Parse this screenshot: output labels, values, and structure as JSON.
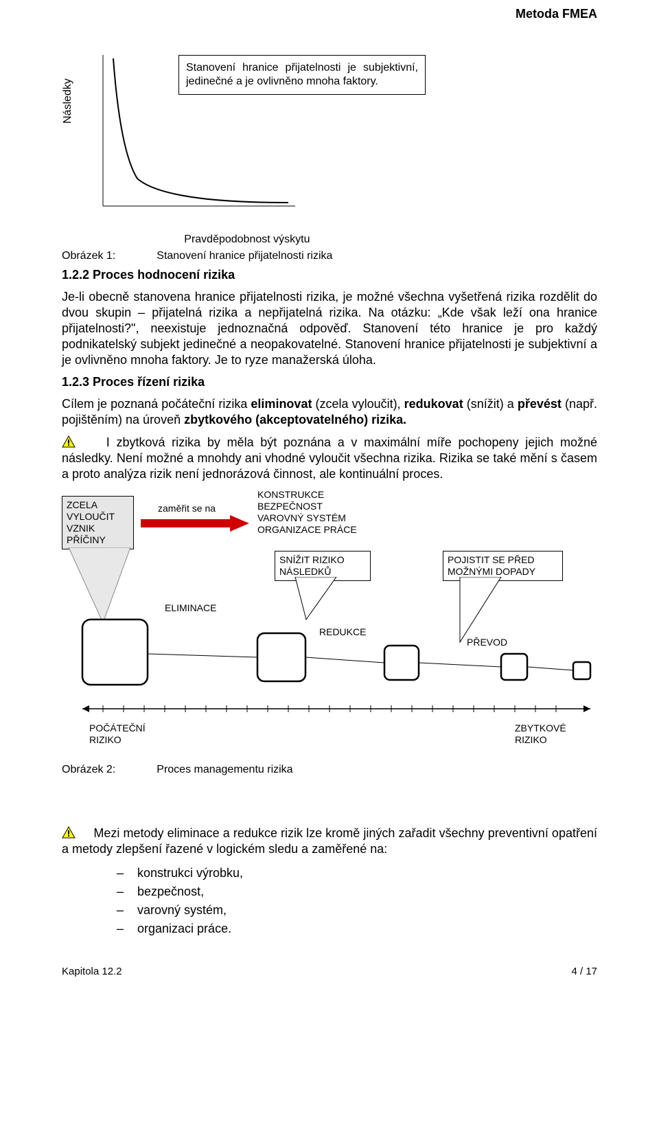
{
  "header": {
    "title": "Metoda FMEA"
  },
  "chart1": {
    "ylabel": "Následky",
    "note": "Stanovení hranice přijatelnosti je subjektivní, jedinečné a je ovlivněno mnoha faktory.",
    "xlabel": "Pravděpodobnost výskytu",
    "caption_left": "Obrázek 1:",
    "caption_right": "Stanovení hranice přijatelnosti rizika"
  },
  "sect122": {
    "title": "1.2.2  Proces hodnocení rizika",
    "p1": "Je-li obecně stanovena hranice přijatelnosti rizika, je možné všechna vyšetřená rizika rozdělit do dvou skupin – přijatelná rizika a nepřijatelná rizika. Na otázku: „Kde však leží ona hranice přijatelnosti?\", neexistuje jednoznačná odpověď. Stanovení této hranice je pro každý podnikatelský subjekt jedinečné a neopakovatelné. Stanovení hranice přijatelnosti je subjektivní a je ovlivněno mnoha faktory. Je to ryze manažerská úloha."
  },
  "sect123": {
    "title": "1.2.3  Proces řízení rizika",
    "p1_a": "Cílem je poznaná počáteční rizika ",
    "p1_b1": "eliminovat",
    "p1_c": " (zcela vyloučit), ",
    "p1_b2": "redukovat",
    "p1_d": " (snížit) a ",
    "p1_b3": "převést",
    "p1_e": " (např. pojištěním) na úroveň ",
    "p1_b4": "zbytkového (akceptovatelného) rizika.",
    "warn_a": "I zbytková rizika by měla být poznána a v maximální míře pochopeny jejich možné následky. Není možné a mnohdy ani vhodné vyloučit všechna rizika. Rizika se také mění s časem a proto analýza rizik není jednorázová činnost, ale kontinuální proces."
  },
  "diagram2": {
    "zcela": "ZCELA\nVYLOUČIT\nVZNIK\nPŘÍČINY",
    "zamerit": "zaměřit se na",
    "konstrukce": "KONSTRUKCE\nBEZPEČNOST\nVAROVNÝ SYSTÉM\nORGANIZACE PRÁCE",
    "snizit": "SNÍŽIT RIZIKO\nNÁSLEDKŮ",
    "pojistit": "POJISTIT SE PŘED\nMOŽNÝMI DOPADY",
    "eliminace": "ELIMINACE",
    "redukce": "REDUKCE",
    "prevod": "PŘEVOD",
    "pocatecni": "POČÁTEČNÍ\nRIZIKO",
    "zbytkove": "ZBYTKOVÉ\nRIZIKO",
    "caption_left": "Obrázek 2:",
    "caption_right": "Proces managementu rizika"
  },
  "warn2": "Mezi metody eliminace a redukce rizik lze kromě jiných zařadit všechny preventivní opatření a metody zlepšení řazené v logickém sledu a zaměřené na:",
  "list": {
    "a": "konstrukci výrobku,",
    "b": "bezpečnost,",
    "c": "varovný systém,",
    "d": "organizaci práce."
  },
  "footer": {
    "left": "Kapitola 12.2",
    "right": "4 / 17"
  }
}
